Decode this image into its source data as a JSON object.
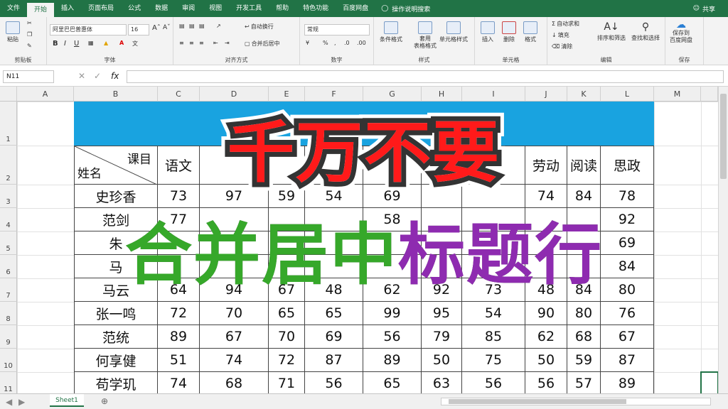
{
  "tabs": [
    "文件",
    "开始",
    "插入",
    "页面布局",
    "公式",
    "数据",
    "审阅",
    "视图",
    "开发工具",
    "帮助",
    "特色功能",
    "百度网盘"
  ],
  "active_tab": "开始",
  "tell_me": "操作说明搜索",
  "share": "共享",
  "ribbon": {
    "clipboard": {
      "paste": "粘贴",
      "name": "剪贴板"
    },
    "font": {
      "font_name": "阿里巴巴普惠体",
      "font_size": "16",
      "bold": "B",
      "italic": "I",
      "underline": "U",
      "name": "字体"
    },
    "alignment": {
      "wrap": "自动换行",
      "merge": "合并后居中",
      "name": "对齐方式"
    },
    "number": {
      "format": "常规",
      "name": "数字"
    },
    "styles": {
      "cond": "条件格式",
      "table": "套用\n表格格式",
      "cell": "单元格样式",
      "name": "样式"
    },
    "cells": {
      "insert": "插入",
      "delete": "删除",
      "format": "格式",
      "name": "单元格"
    },
    "editing": {
      "autosum": "自动求和",
      "fill": "填充",
      "clear": "清除",
      "sort": "排序和筛选",
      "find": "查找和选择",
      "name": "编辑"
    },
    "save": {
      "label": "保存到\n百度网盘",
      "name": "保存"
    }
  },
  "name_box": "N11",
  "columns": [
    "A",
    "B",
    "C",
    "D",
    "E",
    "F",
    "G",
    "H",
    "I",
    "J",
    "K",
    "L",
    "M"
  ],
  "rows": [
    "1",
    "2",
    "3",
    "4",
    "5",
    "6",
    "7",
    "8",
    "9",
    "10",
    "11"
  ],
  "header": {
    "diag_top": "课目",
    "diag_bottom": "姓名",
    "c": "语文",
    "j": "劳动",
    "k": "阅读",
    "l": "思政"
  },
  "names": [
    "史珍香",
    "范剑",
    "朱",
    "马",
    "马云",
    "张一鸣",
    "范统",
    "何享健",
    "苟学玑"
  ],
  "table": [
    [
      "73",
      "97",
      "59",
      "54",
      "69",
      "",
      "",
      "74",
      "84",
      "78"
    ],
    [
      "77",
      "",
      "",
      "",
      "58",
      "",
      "",
      "",
      "",
      "92"
    ],
    [
      "",
      "",
      "",
      "",
      "",
      "",
      "",
      "",
      "",
      "69"
    ],
    [
      "",
      "",
      "",
      "",
      "",
      "",
      "",
      "",
      "",
      "84"
    ],
    [
      "64",
      "94",
      "67",
      "48",
      "62",
      "92",
      "73",
      "48",
      "84",
      "80"
    ],
    [
      "72",
      "70",
      "65",
      "65",
      "99",
      "95",
      "54",
      "90",
      "80",
      "76"
    ],
    [
      "89",
      "67",
      "70",
      "69",
      "56",
      "79",
      "85",
      "62",
      "68",
      "67"
    ],
    [
      "51",
      "74",
      "72",
      "87",
      "89",
      "50",
      "75",
      "50",
      "59",
      "87"
    ],
    [
      "74",
      "68",
      "71",
      "56",
      "65",
      "63",
      "56",
      "56",
      "57",
      "89"
    ]
  ],
  "overlay": {
    "line1": "千万不要",
    "line2a": "合并居中",
    "line2b": "标题行"
  },
  "colors": {
    "green": "#217346",
    "banner": "#19a3e0",
    "red": "#ff1a1a",
    "green_text": "#36a82a",
    "purple": "#8e2bb0"
  },
  "sheet": "Sheet1"
}
